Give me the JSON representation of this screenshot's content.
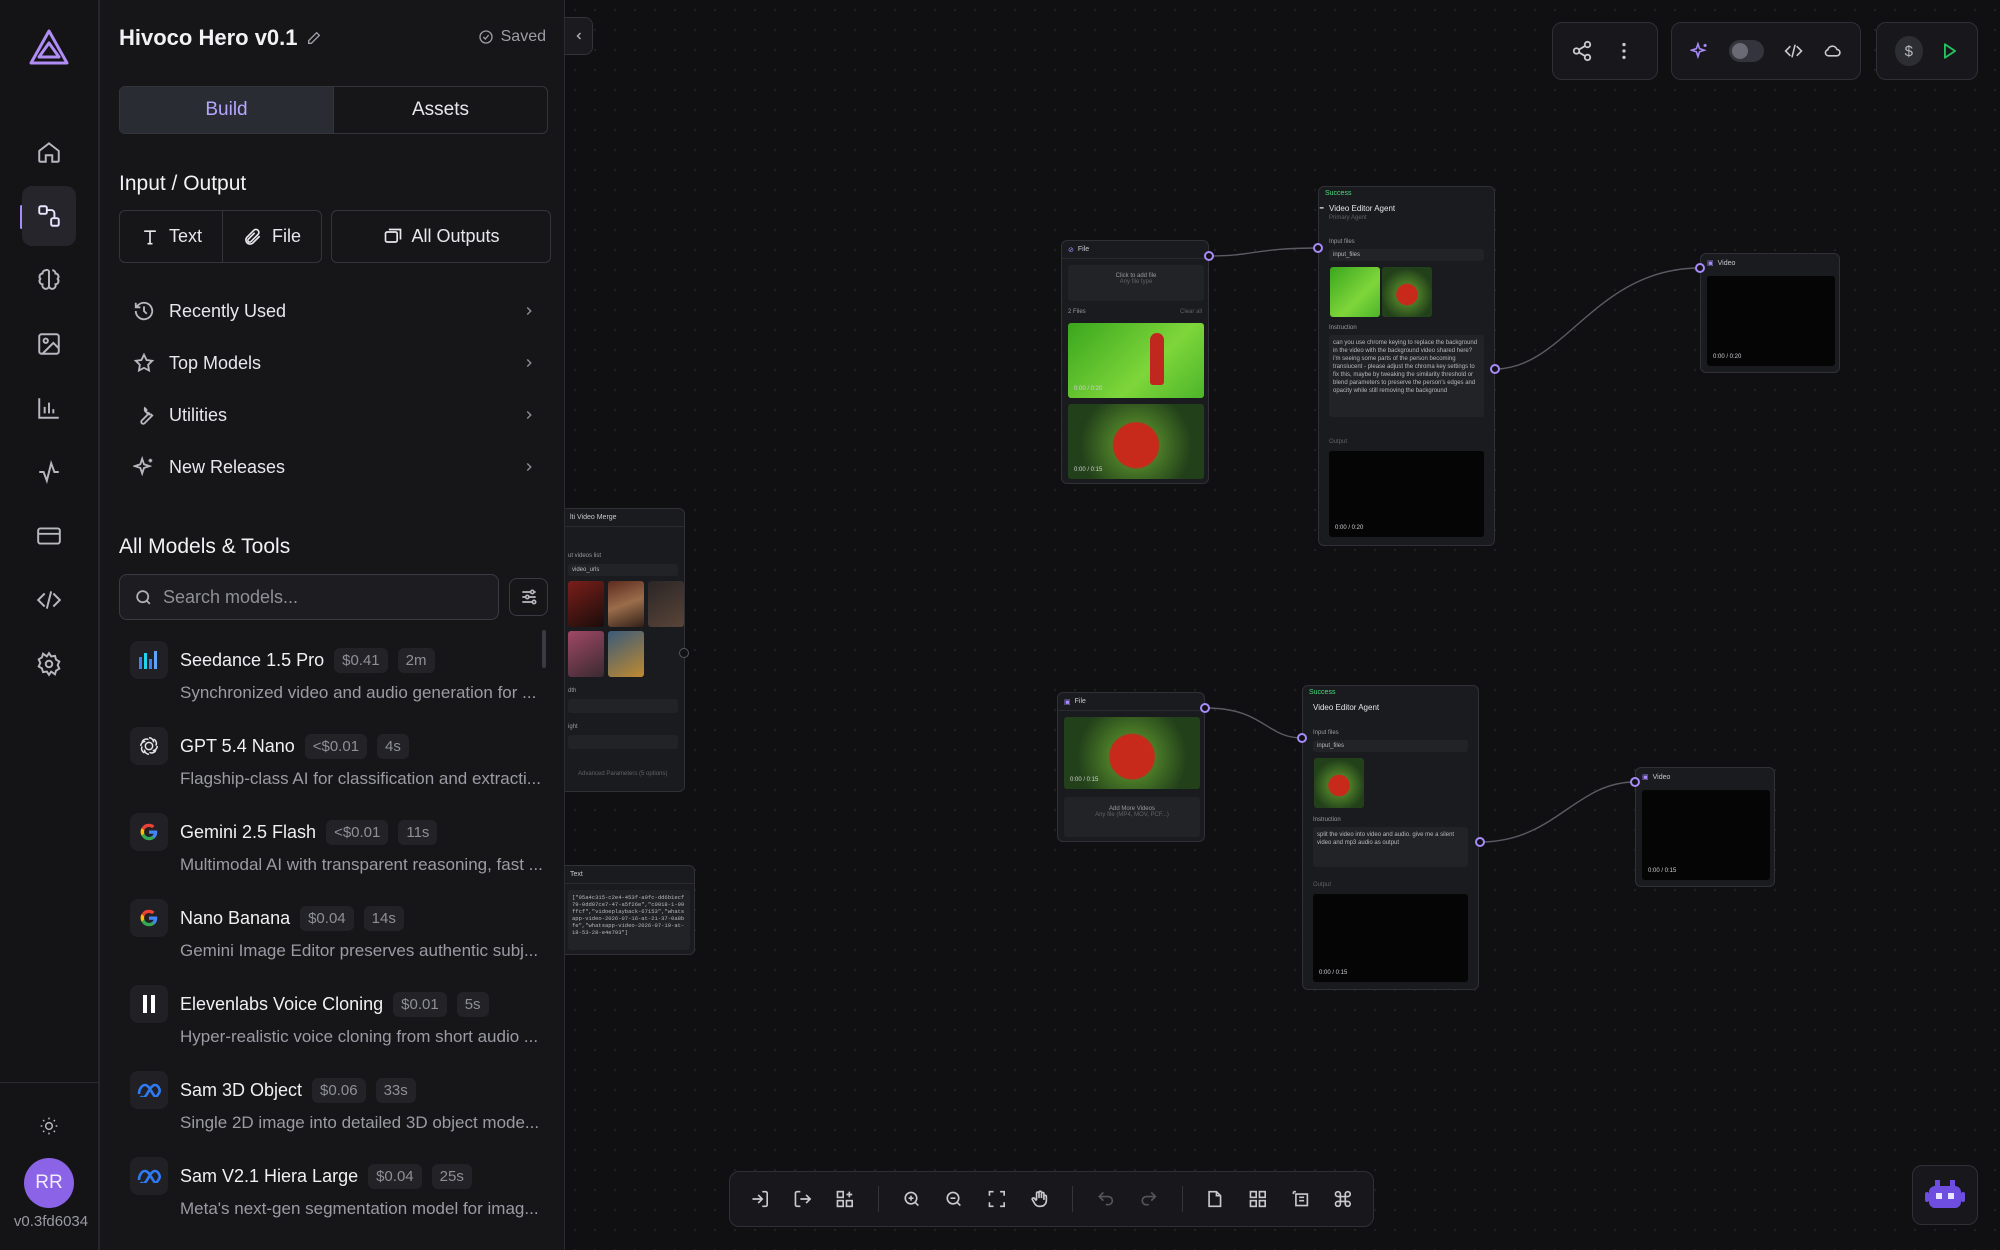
{
  "app": {
    "project_title": "Hivoco Hero v0.1",
    "saved_label": "Saved",
    "version": "v0.3fd6034",
    "avatar_initials": "RR",
    "accent_color": "#a78bfa"
  },
  "rail": {
    "items": [
      "home-icon",
      "workflow-icon",
      "brain-icon",
      "image-icon",
      "chart-icon",
      "activity-icon",
      "billing-icon",
      "code-icon",
      "settings-icon"
    ],
    "active": "workflow-icon"
  },
  "panel": {
    "tabs": [
      "Build",
      "Assets"
    ],
    "active_tab": "Build",
    "io_heading": "Input / Output",
    "io_buttons": {
      "text": "Text",
      "file": "File",
      "all_outputs": "All Outputs"
    },
    "menu": [
      {
        "label": "Recently Used",
        "icon": "history-icon"
      },
      {
        "label": "Top Models",
        "icon": "star-icon"
      },
      {
        "label": "Utilities",
        "icon": "wrench-icon"
      },
      {
        "label": "New Releases",
        "icon": "sparkle-icon"
      }
    ],
    "models_heading": "All Models & Tools",
    "search_placeholder": "Search models...",
    "models": [
      {
        "name": "Seedance 1.5 Pro",
        "price": "$0.41",
        "time": "2m",
        "desc": "Synchronized video and audio generation for ...",
        "icon": "seedance-icon"
      },
      {
        "name": "GPT 5.4 Nano",
        "price": "<$0.01",
        "time": "4s",
        "desc": "Flagship-class AI for classification and extracti...",
        "icon": "openai-icon"
      },
      {
        "name": "Gemini 2.5 Flash",
        "price": "<$0.01",
        "time": "11s",
        "desc": "Multimodal AI with transparent reasoning, fast ...",
        "icon": "google-icon"
      },
      {
        "name": "Nano Banana",
        "price": "$0.04",
        "time": "14s",
        "desc": "Gemini Image Editor preserves authentic subj...",
        "icon": "google-icon"
      },
      {
        "name": "Elevenlabs Voice Cloning",
        "price": "$0.01",
        "time": "5s",
        "desc": "Hyper-realistic voice cloning from short audio ...",
        "icon": "elevenlabs-icon"
      },
      {
        "name": "Sam 3D Object",
        "price": "$0.06",
        "time": "33s",
        "desc": "Single 2D image into detailed 3D object mode...",
        "icon": "meta-icon"
      },
      {
        "name": "Sam V2.1 Hiera Large",
        "price": "$0.04",
        "time": "25s",
        "desc": "Meta's next-gen segmentation model for imag...",
        "icon": "meta-icon"
      }
    ]
  },
  "canvas": {
    "nodes": {
      "file1": {
        "title": "File",
        "hint": "Click to add file",
        "sub": "Any file type",
        "count": "2 Files",
        "clear": "Clear all",
        "t1": "0:00 / 0:20",
        "t2": "0:00 / 0:15"
      },
      "agent1": {
        "status": "Success",
        "title": "Video Editor Agent",
        "subtitle": "Primary Agent",
        "input_label": "Input files",
        "input_var": "input_files",
        "instruction_label": "Instruction",
        "instruction": "can you use chrome keying to replace the background in the video with the background video shared here? i'm seeing some parts of the person becoming translucent - please adjust the chroma key settings to fix this, maybe by tweaking the similarity threshold or blend parameters to preserve the person's edges and opacity while still removing the background",
        "output_label": "Output",
        "t": "0:00 / 0:20"
      },
      "video1": {
        "title": "Video",
        "t": "0:00 / 0:20"
      },
      "merge": {
        "title": "lti Video Merge",
        "list_label": "ut videos list",
        "var": "video_urls",
        "w_label": "dth",
        "h_label": "ight",
        "adv": "Advanced Parameters (5 options)"
      },
      "textnode": {
        "title": "Text",
        "body": "[\"05a4c315-c2e4-453f-a0fc-dd6b1ecf79-0dd07ce7-47-a5f26e\",\"c0018-1-99ffcf\",\"vidoeplayback-67153\",\"whatsapp-video-2026-07-16-at-21-37-0a8bfe\",\"whatsapp-video-2026-07-19-at-18-53-28-e4e793\"]"
      },
      "file2": {
        "title": "File",
        "t": "0:00 / 0:15",
        "add": "Add More Videos",
        "sub": "Any file (MP4, MOV, PCF...)"
      },
      "agent2": {
        "status": "Success",
        "title": "Video Editor Agent",
        "input_label": "Input files",
        "input_var": "input_files",
        "instruction_label": "Instruction",
        "instruction": "split the video into video and audio. give me a silent video and mp3 audio as output",
        "output_label": "Output",
        "t": "0:00 / 0:15"
      },
      "video2": {
        "title": "Video",
        "t": "0:00 / 0:15"
      }
    }
  },
  "toolbars": {
    "top_left": [
      "share-icon",
      "more-icon"
    ],
    "top_mid": [
      "ai-sparkle-icon",
      "toggle",
      "code-icon",
      "cloud-icon"
    ],
    "top_right": [
      "dollar-icon",
      "run-icon"
    ],
    "coin_label": "$",
    "bottom": [
      "import-icon",
      "export-icon",
      "add-node-icon",
      "zoom-in-icon",
      "zoom-out-icon",
      "fit-view-icon",
      "pan-icon",
      "undo-icon",
      "redo-icon",
      "note-icon",
      "grid-icon",
      "layout-icon",
      "shortcut-icon"
    ]
  }
}
